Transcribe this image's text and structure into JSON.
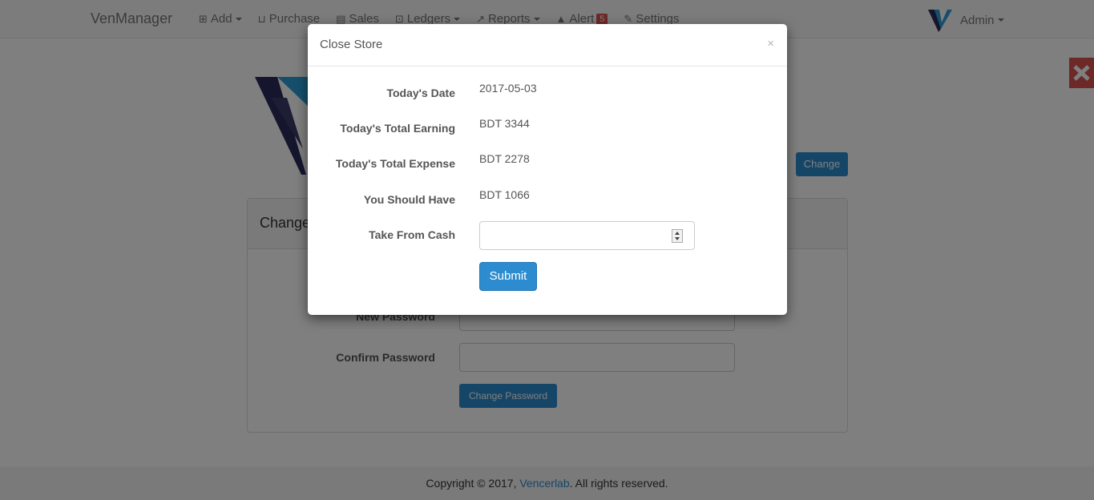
{
  "navbar": {
    "brand": "VenManager",
    "items": [
      {
        "label": "Add",
        "icon": "plus-square-icon",
        "has_caret": true
      },
      {
        "label": "Purchase",
        "icon": "basket-icon",
        "has_caret": false
      },
      {
        "label": "Sales",
        "icon": "file-icon",
        "has_caret": false
      },
      {
        "label": "Ledgers",
        "icon": "ledger-icon",
        "has_caret": true
      },
      {
        "label": "Reports",
        "icon": "line-chart-icon",
        "has_caret": true
      },
      {
        "label": "Alert",
        "icon": "warning-icon",
        "badge": "5"
      },
      {
        "label": "Settings",
        "icon": "wrench-icon",
        "has_caret": false
      }
    ],
    "user": "Admin"
  },
  "page": {
    "change_button": "Change",
    "panel_title": "Change",
    "new_password_label": "New Password",
    "confirm_password_label": "Confirm Password",
    "change_password_button": "Change Password"
  },
  "footer": {
    "prefix": "Copyright © 2017, ",
    "link": "Vencerlab",
    "suffix": ". All rights reserved."
  },
  "modal": {
    "title": "Close Store",
    "close": "×",
    "rows": [
      {
        "label": "Today's Date",
        "value": "2017-05-03"
      },
      {
        "label": "Today's Total Earning",
        "value": "BDT 3344"
      },
      {
        "label": "Today's Total Expense",
        "value": "BDT 2278"
      },
      {
        "label": "You Should Have",
        "value": "BDT 1066"
      }
    ],
    "cash_label": "Take From Cash",
    "cash_value": "",
    "submit": "Submit"
  },
  "colors": {
    "primary": "#2c8ccf",
    "danger": "#d9534f"
  }
}
